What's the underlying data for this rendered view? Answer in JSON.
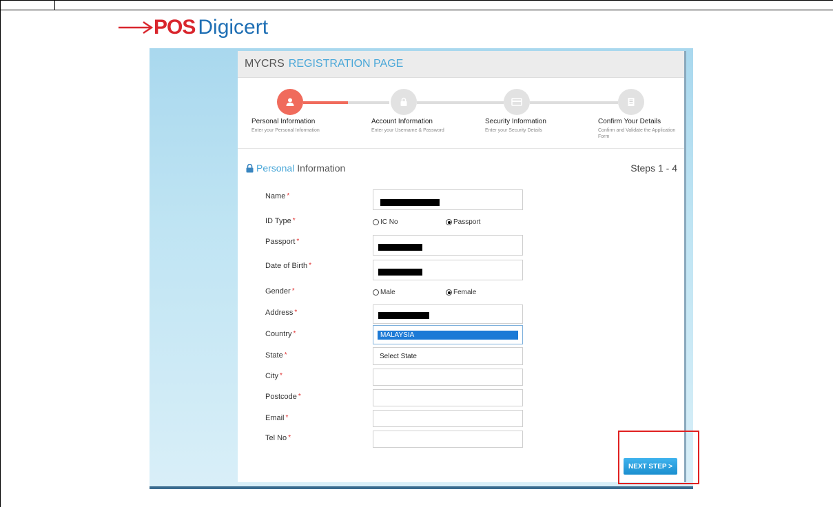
{
  "brand": {
    "pos": "POS",
    "digicert": "Digicert"
  },
  "page": {
    "title_part1": "MYCRS",
    "title_part2": "REGISTRATION PAGE"
  },
  "steps": [
    {
      "title": "Personal Information",
      "subtitle": "Enter your Personal Information",
      "icon": "user-icon",
      "active": true
    },
    {
      "title": "Account Information",
      "subtitle": "Enter your Username & Password",
      "icon": "lock-icon",
      "active": false
    },
    {
      "title": "Security Information",
      "subtitle": "Enter your Security Details",
      "icon": "card-icon",
      "active": false
    },
    {
      "title": "Confirm Your Details",
      "subtitle": "Confirm and Validate the Application Form",
      "icon": "document-icon",
      "active": false
    }
  ],
  "section": {
    "title_highlight": "Personal",
    "title_rest": "Information",
    "steps_count": "Steps 1 - 4"
  },
  "form": {
    "required_marker": "*",
    "name_label": "Name",
    "idtype_label": "ID Type",
    "idtype_options": [
      "IC No",
      "Passport"
    ],
    "idtype_selected": "Passport",
    "passport_label": "Passport",
    "dob_label": "Date of Birth",
    "gender_label": "Gender",
    "gender_options": [
      "Male",
      "Female"
    ],
    "gender_selected": "Female",
    "address_label": "Address",
    "country_label": "Country",
    "country_value": "MALAYSIA",
    "state_label": "State",
    "state_value": "Select State",
    "city_label": "City",
    "postcode_label": "Postcode",
    "email_label": "Email",
    "tel_label": "Tel No"
  },
  "actions": {
    "next_label": "NEXT STEP >"
  },
  "colors": {
    "accent_red": "#f06b5c",
    "accent_blue": "#4aa7d8",
    "button_blue": "#1b8fcf",
    "highlight_red": "#e02020"
  }
}
